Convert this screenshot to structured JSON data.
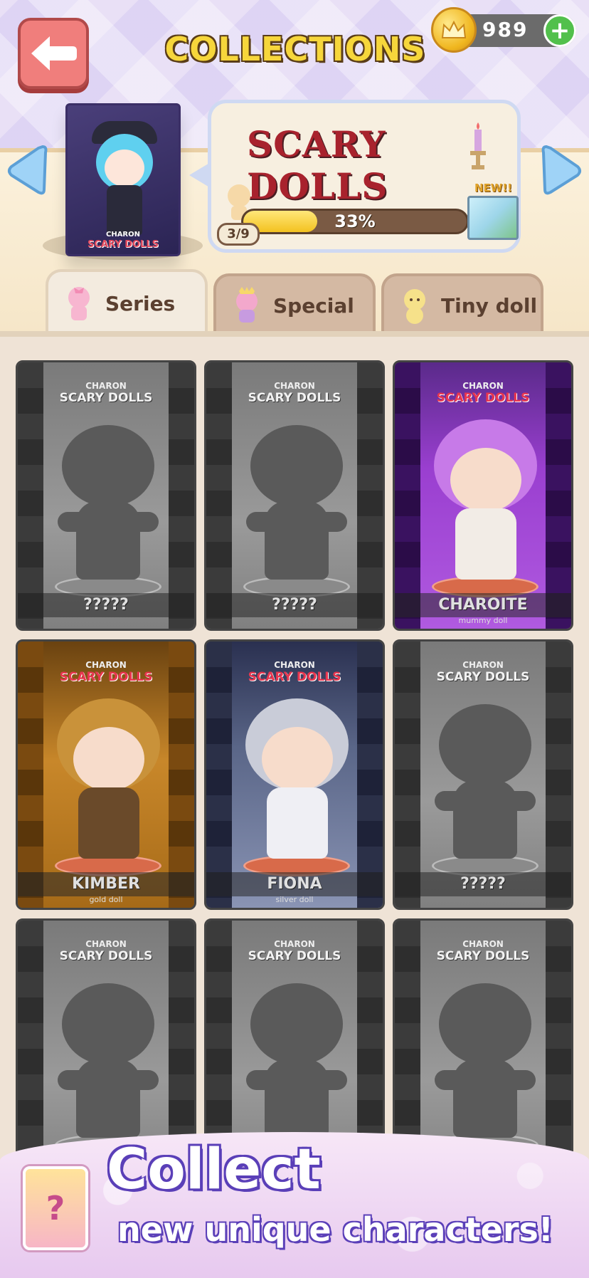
{
  "header": {
    "title": "COLLECTIONS",
    "coins": "989",
    "plus_label": "+"
  },
  "series": {
    "name": "SCARY DOLLS",
    "box_brand": "CHARON",
    "box_label": "SCARY DOLLS",
    "progress_percent": 33,
    "progress_text": "33%",
    "collected_count": "3/9",
    "new_label": "NEW!!"
  },
  "tabs": [
    {
      "label": "Series",
      "active": true
    },
    {
      "label": "Special",
      "active": false
    },
    {
      "label": "Tiny doll",
      "active": false
    }
  ],
  "cards": [
    {
      "brand_small": "CHARON",
      "brand": "SCARY DOLLS",
      "name": "?????",
      "subtitle": "",
      "state": "locked"
    },
    {
      "brand_small": "CHARON",
      "brand": "SCARY DOLLS",
      "name": "?????",
      "subtitle": "",
      "state": "locked"
    },
    {
      "brand_small": "CHARON",
      "brand": "SCARY DOLLS",
      "name": "CHAROITE",
      "subtitle": "mummy doll",
      "state": "purple"
    },
    {
      "brand_small": "CHARON",
      "brand": "SCARY DOLLS",
      "name": "KIMBER",
      "subtitle": "gold doll",
      "state": "gold"
    },
    {
      "brand_small": "CHARON",
      "brand": "SCARY DOLLS",
      "name": "FIONA",
      "subtitle": "silver doll",
      "state": "silver"
    },
    {
      "brand_small": "CHARON",
      "brand": "SCARY DOLLS",
      "name": "?????",
      "subtitle": "",
      "state": "locked"
    },
    {
      "brand_small": "CHARON",
      "brand": "SCARY DOLLS",
      "name": "",
      "subtitle": "",
      "state": "locked"
    },
    {
      "brand_small": "CHARON",
      "brand": "SCARY DOLLS",
      "name": "",
      "subtitle": "",
      "state": "locked"
    },
    {
      "brand_small": "CHARON",
      "brand": "SCARY DOLLS",
      "name": "?????",
      "subtitle": "",
      "state": "locked"
    }
  ],
  "promo": {
    "title": "Collect",
    "subtitle": "new unique characters!",
    "card_glyph": "?"
  },
  "colors": {
    "accent_red": "#e8364f",
    "coin_gold": "#f0b61e",
    "tab_bg": "#d4b9a3",
    "promo_outline": "#5a3fb8"
  }
}
